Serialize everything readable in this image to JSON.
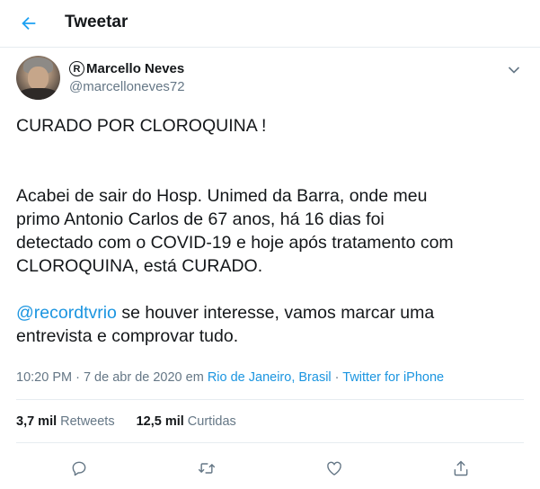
{
  "header": {
    "title": "Tweetar",
    "back_icon": "arrow-left-icon"
  },
  "author": {
    "name": "Marcello Neves",
    "badge": "R",
    "handle": "@marcelloneves72"
  },
  "tweet": {
    "headline": "CURADO POR CLOROQUINA !",
    "para1_lines": [
      "Acabei de sair do Hosp. Unimed da Barra, onde meu",
      "primo Antonio Carlos de 67 anos, há 16 dias foi",
      "detectado com o COVID-19 e hoje após tratamento com",
      "CLOROQUINA, está CURADO."
    ],
    "mention": "@recordtvrio",
    "para2_line1_rest": " se houver interesse, vamos marcar uma",
    "para2_line2": "entrevista e comprovar tudo."
  },
  "meta": {
    "time": "10:20 PM",
    "sep1": " · ",
    "date": "7 de abr de 2020",
    "em": " em ",
    "location": "Rio de Janeiro, Brasil",
    "sep2": " · ",
    "source": "Twitter for iPhone"
  },
  "stats": {
    "retweets_count": "3,7 mil",
    "retweets_label": "Retweets",
    "likes_count": "12,5 mil",
    "likes_label": "Curtidas"
  },
  "actions": [
    "reply-icon",
    "retweet-icon",
    "like-icon",
    "share-icon"
  ],
  "colors": {
    "accent": "#1da1f2",
    "link": "#1b95e0",
    "muted": "#657786",
    "text": "#14171a",
    "border": "#e6ecf0"
  }
}
